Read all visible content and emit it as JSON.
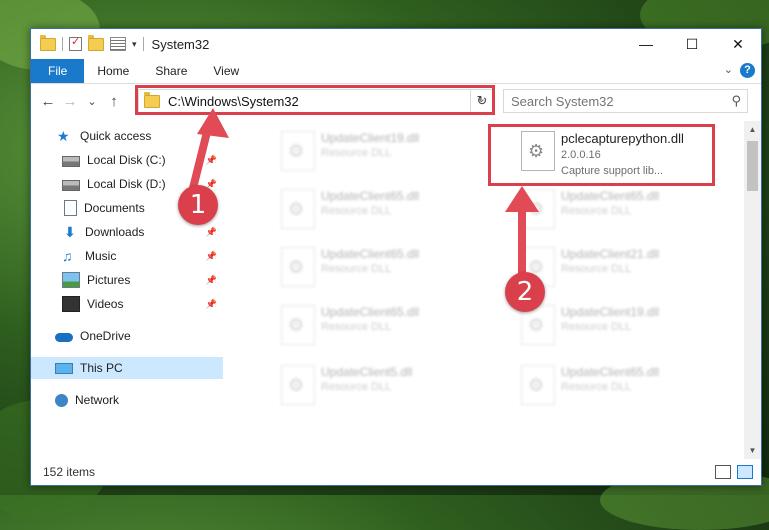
{
  "window": {
    "title": "System32",
    "controls": {
      "minimize": "—",
      "maximize": "☐",
      "close": "✕"
    }
  },
  "ribbon": {
    "tabs": [
      "File",
      "Home",
      "Share",
      "View"
    ],
    "help": "?"
  },
  "navigation": {
    "back": "←",
    "forward": "→",
    "recent": "⌄",
    "up": "↑",
    "address": "C:\\Windows\\System32",
    "refresh": "↻",
    "search_placeholder": "Search System32"
  },
  "sidebar": {
    "items": [
      {
        "label": "Quick access",
        "icon": "star-icon"
      },
      {
        "label": "Local Disk (C:)",
        "icon": "disk-icon",
        "pinned": true
      },
      {
        "label": "Local Disk (D:)",
        "icon": "disk-icon",
        "pinned": true
      },
      {
        "label": "Documents",
        "icon": "documents-icon",
        "pinned": true
      },
      {
        "label": "Downloads",
        "icon": "downloads-icon",
        "pinned": true
      },
      {
        "label": "Music",
        "icon": "music-icon",
        "pinned": true
      },
      {
        "label": "Pictures",
        "icon": "pictures-icon",
        "pinned": true
      },
      {
        "label": "Videos",
        "icon": "videos-icon",
        "pinned": true
      },
      {
        "label": "OneDrive",
        "icon": "cloud-icon"
      },
      {
        "label": "This PC",
        "icon": "computer-icon",
        "selected": true
      },
      {
        "label": "Network",
        "icon": "network-icon"
      }
    ]
  },
  "files": {
    "focused": {
      "name": "pclecapturepython.dll",
      "version": "2.0.0.16",
      "description": "Capture support lib..."
    },
    "blurred": [
      {
        "name": "UpdateClient19.dll",
        "type": "Resource DLL"
      },
      {
        "name": "UpdateClient65.dll",
        "type": "Resource DLL"
      },
      {
        "name": "UpdateClient65.dll",
        "type": "Resource DLL"
      },
      {
        "name": "UpdateClient65.dll",
        "type": "Resource DLL"
      },
      {
        "name": "UpdateClient65.dll",
        "type": "Resource DLL"
      },
      {
        "name": "UpdateClient21.dll",
        "type": "Resource DLL"
      },
      {
        "name": "UpdateClient65.dll",
        "type": "Resource DLL"
      },
      {
        "name": "UpdateClient19.dll",
        "type": "Resource DLL"
      },
      {
        "name": "UpdateClient5.dll",
        "type": "Resource DLL"
      },
      {
        "name": "UpdateClient65.dll",
        "type": "Resource DLL"
      }
    ]
  },
  "status": {
    "item_count": "152 items"
  },
  "annotations": {
    "step1": "1",
    "step2": "2"
  },
  "colors": {
    "accent": "#1979ca",
    "highlight": "#d9404b",
    "selection": "#cce8ff"
  }
}
